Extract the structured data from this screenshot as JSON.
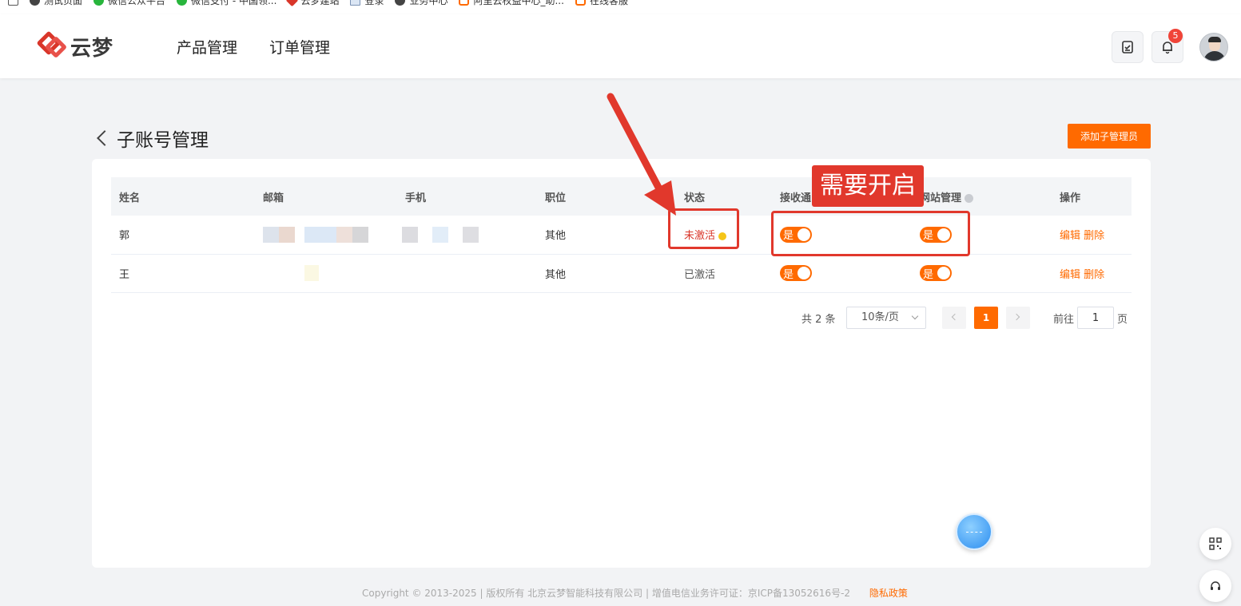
{
  "bookmarks": [
    {
      "label": "测试页面",
      "icon": "globe-icon"
    },
    {
      "label": "微信公众平台",
      "icon": "wechat-icon"
    },
    {
      "label": "微信支付 - 中国领...",
      "icon": "wechat-icon"
    },
    {
      "label": "云梦建站",
      "icon": "yunmeng-icon"
    },
    {
      "label": "登录",
      "icon": "document-icon"
    },
    {
      "label": "业务中心",
      "icon": "globe-icon"
    },
    {
      "label": "阿里云权益中心_助...",
      "icon": "aliyun-icon"
    },
    {
      "label": "在线客服",
      "icon": "aliyun-icon"
    }
  ],
  "header": {
    "logo_text": "云梦",
    "nav": [
      "产品管理",
      "订单管理"
    ],
    "notification_count": "5"
  },
  "page": {
    "title": "子账号管理",
    "add_button": "添加子管理员"
  },
  "table": {
    "columns": [
      "姓名",
      "邮箱",
      "手机",
      "职位",
      "状态",
      "接收通",
      "网站管理",
      "操作"
    ],
    "rows": [
      {
        "name": "郭",
        "position": "其他",
        "status": "未激活",
        "receive": "是",
        "site_manage": "是",
        "edit": "编辑",
        "delete": "删除"
      },
      {
        "name": "王",
        "position": "其他",
        "status": "已激活",
        "receive": "是",
        "site_manage": "是",
        "edit": "编辑",
        "delete": "删除"
      }
    ]
  },
  "pagination": {
    "total": "共 2 条",
    "page_size": "10条/页",
    "current_page": "1",
    "goto_label": "前往",
    "goto_value": "1",
    "goto_suffix": "页"
  },
  "annotation": {
    "label": "需要开启"
  },
  "footer": {
    "copyright": "Copyright © 2013-2025 | 版权所有 北京云梦智能科技有限公司 | 增值电信业务许可证：京ICP备13052616号-2",
    "privacy": "隐私政策"
  },
  "colors": {
    "accent": "#ff6a00",
    "annotation": "#e1382c",
    "inactive": "#d9362a"
  }
}
